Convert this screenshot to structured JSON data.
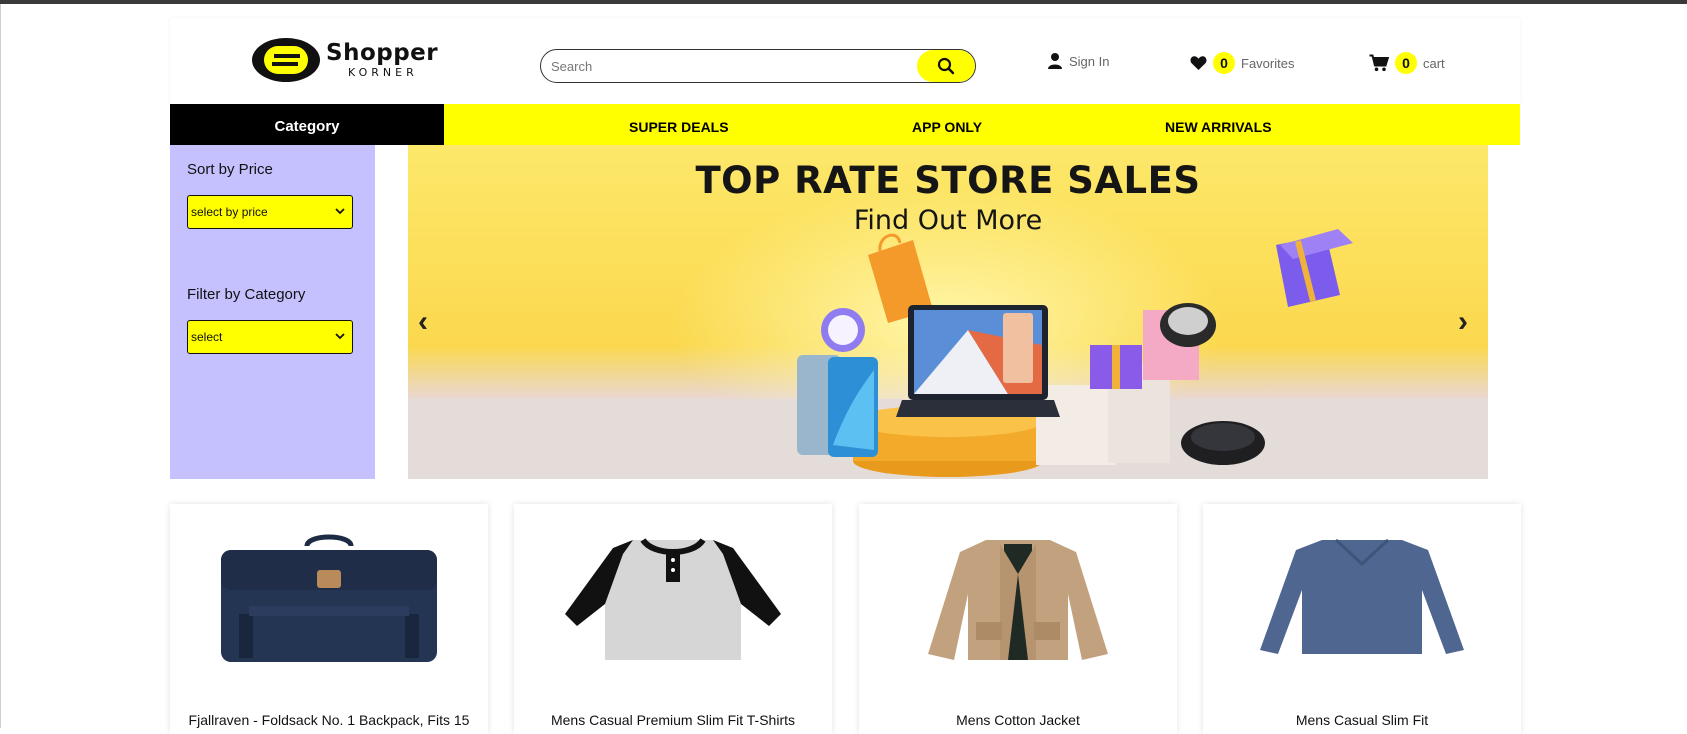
{
  "brand": {
    "name": "Shopper",
    "sub": "KORNER"
  },
  "search": {
    "placeholder": "Search"
  },
  "header": {
    "signin": "Sign In",
    "favorites_count": "0",
    "favorites_label": "Favorites",
    "cart_count": "0",
    "cart_label": "cart"
  },
  "nav": {
    "category": "Category",
    "links": [
      "SUPER DEALS",
      "APP ONLY",
      "NEW ARRIVALS"
    ]
  },
  "sidebar": {
    "sort_label": "Sort by Price",
    "sort_value": "select by price",
    "filter_label": "Filter by Category",
    "filter_value": "select"
  },
  "banner": {
    "title": "TOP RATE STORE SALES",
    "subtitle": "Find Out More",
    "prev": "‹",
    "next": "›"
  },
  "products": [
    {
      "title": "Fjallraven - Foldsack No. 1 Backpack, Fits 15",
      "image": "backpack-navy"
    },
    {
      "title": "Mens Casual Premium Slim Fit T-Shirts",
      "image": "raglan-tshirt"
    },
    {
      "title": "Mens Cotton Jacket",
      "image": "cotton-jacket"
    },
    {
      "title": "Mens Casual Slim Fit",
      "image": "longsleeve-blue"
    }
  ],
  "colors": {
    "accent": "#ffff00",
    "sidebar": "#c5c1ff",
    "nav_dark": "#000000"
  }
}
